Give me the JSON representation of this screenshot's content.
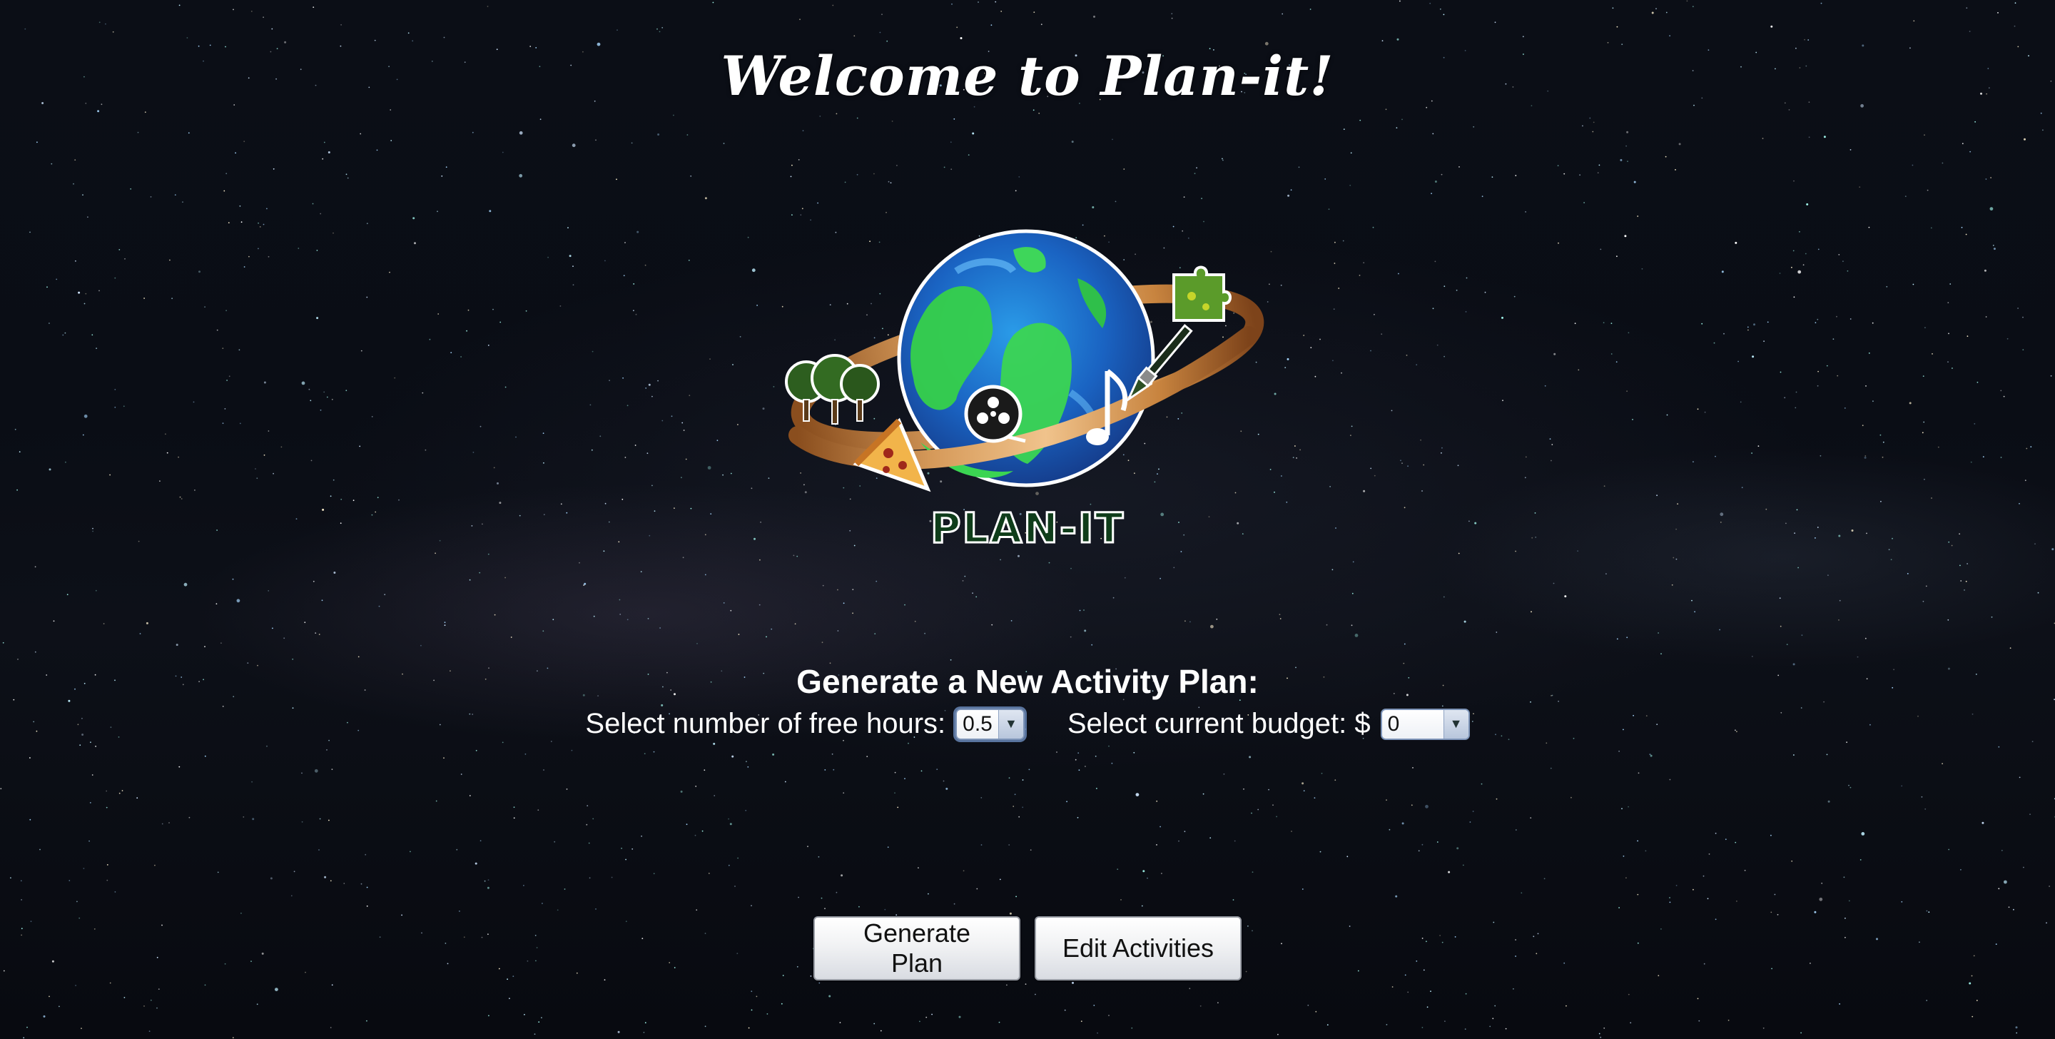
{
  "page": {
    "title": "Welcome to Plan-it!"
  },
  "logo": {
    "text": "PLAN-IT",
    "icons": [
      "trees-icon",
      "pizza-slice-icon",
      "film-reel-icon",
      "music-note-icon",
      "paintbrush-icon",
      "puzzle-piece-icon",
      "planet-icon"
    ]
  },
  "plan_form": {
    "heading": "Generate a New Activity Plan:",
    "hours_label": "Select number of free hours:",
    "hours_value": "0.5",
    "budget_label": "Select current budget: $",
    "budget_value": "0"
  },
  "buttons": {
    "generate": "Generate Plan",
    "edit": "Edit Activities"
  },
  "colors": {
    "background": "#0a0d15",
    "ocean": "#1f7fd0",
    "land": "#36d04a",
    "ring": "#c7874a"
  }
}
